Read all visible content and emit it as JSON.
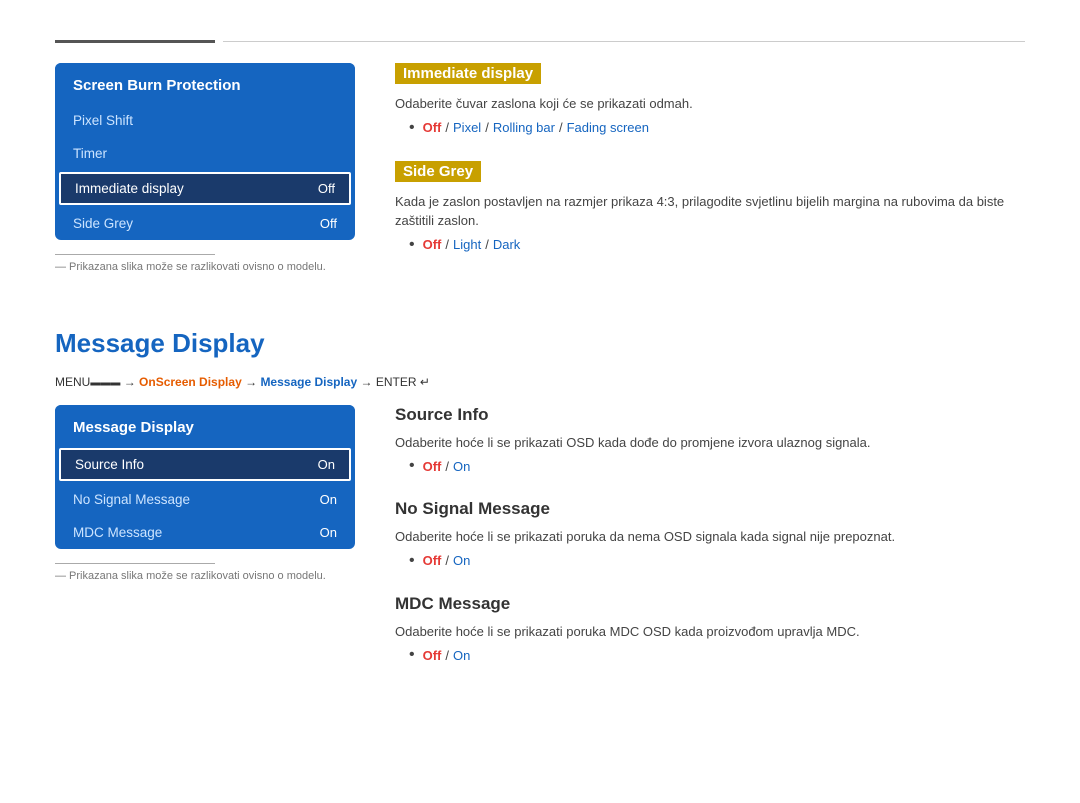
{
  "topDivider": true,
  "section1": {
    "menu": {
      "title": "Screen Burn Protection",
      "items": [
        {
          "label": "Pixel Shift",
          "value": "",
          "active": false
        },
        {
          "label": "Timer",
          "value": "",
          "active": false
        },
        {
          "label": "Immediate display",
          "value": "Off",
          "active": true
        },
        {
          "label": "Side Grey",
          "value": "Off",
          "active": false
        }
      ]
    },
    "note": "― Prikazana slika može se razlikovati ovisno o modelu.",
    "right": {
      "blocks": [
        {
          "id": "immediate-display",
          "titleHighlighted": true,
          "title": "Immediate display",
          "desc": "Odaberite čuvar zaslona koji će se prikazati odmah.",
          "bulletPrefix": "•",
          "options": [
            {
              "text": "Off",
              "style": "off"
            },
            {
              "text": " / ",
              "style": "sep"
            },
            {
              "text": "Pixel",
              "style": "normal"
            },
            {
              "text": " / ",
              "style": "sep"
            },
            {
              "text": "Rolling bar",
              "style": "normal"
            },
            {
              "text": " / ",
              "style": "sep"
            },
            {
              "text": "Fading screen",
              "style": "normal"
            }
          ]
        },
        {
          "id": "side-grey",
          "titleHighlighted": true,
          "title": "Side Grey",
          "desc": "Kada je zaslon postavljen na razmjer prikaza 4:3, prilagodite svjetlinu bijelih margina na rubovima da biste zaštitili zaslon.",
          "bulletPrefix": "•",
          "options": [
            {
              "text": "Off",
              "style": "off"
            },
            {
              "text": " / ",
              "style": "sep"
            },
            {
              "text": "Light",
              "style": "normal"
            },
            {
              "text": " / ",
              "style": "sep"
            },
            {
              "text": "Dark",
              "style": "normal"
            }
          ]
        }
      ]
    }
  },
  "section2": {
    "pageTitle": "Message Display",
    "breadcrumb": {
      "parts": [
        {
          "text": "MENU",
          "style": "normal"
        },
        {
          "text": "III",
          "style": "normal"
        },
        {
          "text": " → ",
          "style": "normal"
        },
        {
          "text": "OnScreen Display",
          "style": "orange"
        },
        {
          "text": " → ",
          "style": "normal"
        },
        {
          "text": "Message Display",
          "style": "blue"
        },
        {
          "text": " → ENTER",
          "style": "normal"
        },
        {
          "text": "↵",
          "style": "normal"
        }
      ]
    },
    "menu": {
      "title": "Message Display",
      "items": [
        {
          "label": "Source Info",
          "value": "On",
          "active": true
        },
        {
          "label": "No Signal Message",
          "value": "On",
          "active": false
        },
        {
          "label": "MDC Message",
          "value": "On",
          "active": false
        }
      ]
    },
    "note": "― Prikazana slika može se razlikovati ovisno o modelu.",
    "right": {
      "blocks": [
        {
          "id": "source-info",
          "titleHighlighted": false,
          "title": "Source Info",
          "desc": "Odaberite hoće li se prikazati OSD kada dođe do promjene izvora ulaznog signala.",
          "bulletPrefix": "•",
          "options": [
            {
              "text": "Off",
              "style": "off"
            },
            {
              "text": " / ",
              "style": "sep"
            },
            {
              "text": "On",
              "style": "normal"
            }
          ]
        },
        {
          "id": "no-signal-message",
          "titleHighlighted": false,
          "title": "No Signal Message",
          "desc": "Odaberite hoće li se prikazati poruka da nema OSD signala kada signal nije prepoznat.",
          "bulletPrefix": "•",
          "options": [
            {
              "text": "Off",
              "style": "off"
            },
            {
              "text": " / ",
              "style": "sep"
            },
            {
              "text": "On",
              "style": "normal"
            }
          ]
        },
        {
          "id": "mdc-message",
          "titleHighlighted": false,
          "title": "MDC Message",
          "desc": "Odaberite hoće li se prikazati poruka MDC OSD kada proizvođom upravlja MDC.",
          "bulletPrefix": "•",
          "options": [
            {
              "text": "Off",
              "style": "off"
            },
            {
              "text": " / ",
              "style": "sep"
            },
            {
              "text": "On",
              "style": "normal"
            }
          ]
        }
      ]
    }
  }
}
